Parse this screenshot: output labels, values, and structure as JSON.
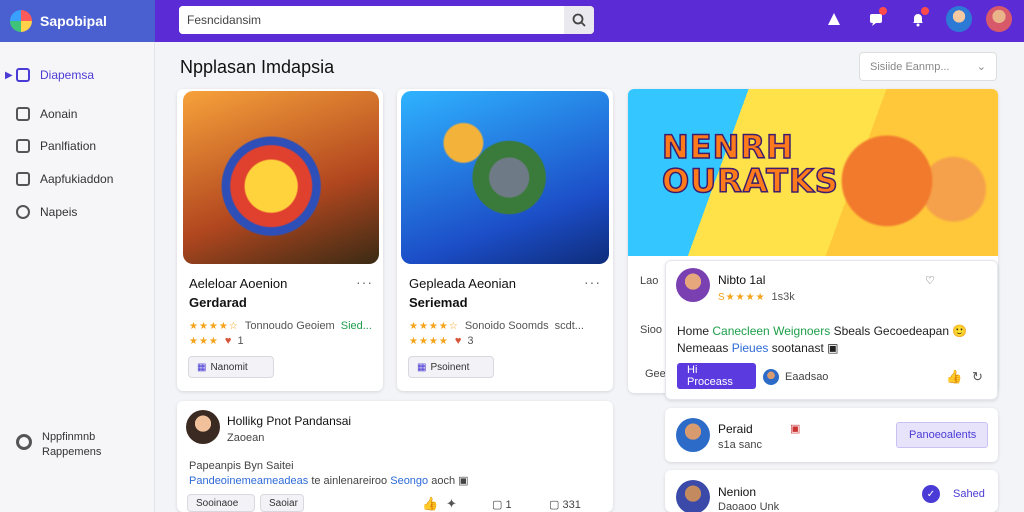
{
  "app": {
    "title": "Sapobipal"
  },
  "search": {
    "value": "Fesncidansim",
    "placeholder": ""
  },
  "sidebar": {
    "items": [
      {
        "label": "Diapemsa",
        "icon": "calendar-icon",
        "active": true
      },
      {
        "label": "Aonain",
        "icon": "inbox-icon"
      },
      {
        "label": "Panlfiation",
        "icon": "comment-icon"
      },
      {
        "label": "Aapfukiaddon",
        "icon": "image-icon"
      },
      {
        "label": "Napeis",
        "icon": "shield-icon"
      }
    ],
    "footer": {
      "line1": "Nppfinmnb",
      "line2": "Rappemens"
    }
  },
  "main": {
    "title": "Npplasan Imdapsia",
    "sort_label": "Sisiide Eanmp..."
  },
  "cards": [
    {
      "title1": "Aeleloar Aoenion",
      "title2": "Gerdarad",
      "rating_text": "Tonnoudo Geoiem",
      "rating_extra": "Sied...",
      "count": "1",
      "chip": "Nanomit"
    },
    {
      "title1": "Gepleada Aeonian",
      "title2": "Seriemad",
      "rating_text": "Sonoido Soomds",
      "rating_extra": "scdt...",
      "count": "3",
      "chip": "Psoinent"
    }
  ],
  "hero": {
    "title_line1": "NENRH",
    "title_line2": "OURATKS",
    "side_text1": "Lao",
    "side_text2": "Sioo",
    "side_text3": "Gee"
  },
  "review": {
    "name": "Nibto 1al",
    "rating": "1s3k",
    "text_line1_a": "Home",
    "text_line1_b": "Canecleen",
    "text_line1_c": "Weignoers",
    "text_line1_d": "Sbeals Gecoedeapan",
    "text_line2_a": "Nemeaas",
    "text_line2_b": "Pieues",
    "text_line2_c": "sootanast",
    "button": "Hi Proceass",
    "user": "Eaadsao"
  },
  "people": [
    {
      "name": "Peraid",
      "meta": "s1a sanc",
      "button": "Panoeoalents"
    },
    {
      "name": "Nenion",
      "meta": "Daoaoo Unk",
      "action": "Sahed"
    }
  ],
  "post": {
    "author": "Hollikg Pnot Pandansai",
    "meta": "Zaoean",
    "line1": "Papeanpis Byn Saitei",
    "line2_a": "Pandeoinemeameadeas",
    "line2_b": "te ainlenareiroo",
    "line2_c": "Seongo",
    "line2_d": "aoch",
    "chip1": "Sooinaoe",
    "chip2": "Saoiar",
    "count1": "1",
    "count2": "331"
  }
}
